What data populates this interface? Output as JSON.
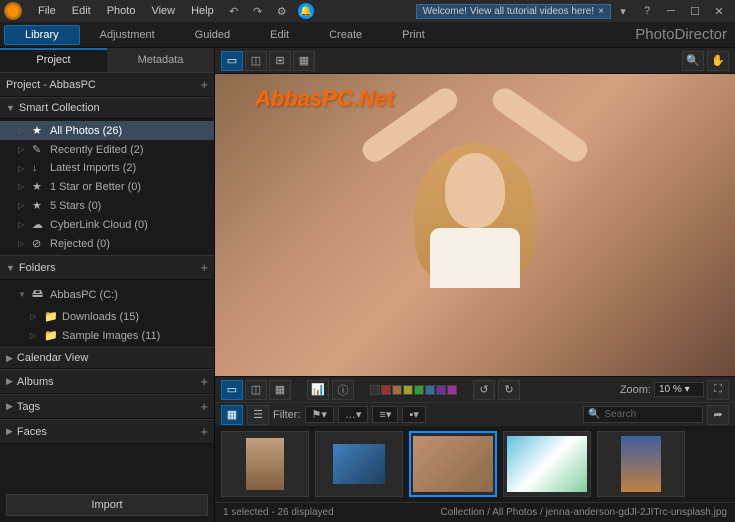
{
  "menu": {
    "file": "File",
    "edit": "Edit",
    "photo": "Photo",
    "view": "View",
    "help": "Help"
  },
  "welcome_banner": "Welcome! View all tutorial videos here!",
  "brand": "PhotoDirector",
  "modes": {
    "library": "Library",
    "adjustment": "Adjustment",
    "guided": "Guided",
    "edit": "Edit",
    "create": "Create",
    "print": "Print"
  },
  "side_tabs": {
    "project": "Project",
    "metadata": "Metadata"
  },
  "project_header": "Project - AbbasPC",
  "panels": {
    "smart_collection": {
      "title": "Smart Collection",
      "items": [
        {
          "label": "All Photos (26)",
          "icon": "★"
        },
        {
          "label": "Recently Edited (2)",
          "icon": "✎"
        },
        {
          "label": "Latest Imports (2)",
          "icon": "↓"
        },
        {
          "label": "1 Star or Better (0)",
          "icon": "★"
        },
        {
          "label": "5 Stars (0)",
          "icon": "★"
        },
        {
          "label": "CyberLink Cloud (0)",
          "icon": "☁"
        },
        {
          "label": "Rejected (0)",
          "icon": "⊘"
        }
      ]
    },
    "folders": {
      "title": "Folders",
      "root": "AbbasPC (C:)",
      "children": [
        {
          "label": "Downloads (15)"
        },
        {
          "label": "Sample Images (11)"
        }
      ]
    },
    "calendar": "Calendar View",
    "albums": "Albums",
    "tags": "Tags",
    "faces": "Faces"
  },
  "import_btn": "Import",
  "watermark": "AbbasPC.Net",
  "filmstrip_toolbar": {
    "zoom_label": "Zoom:",
    "zoom_value": "10 %"
  },
  "filter_toolbar": {
    "filter_label": "Filter:",
    "search_placeholder": "Search"
  },
  "statusbar": {
    "left": "1 selected - 26 displayed",
    "right": "Collection / All Photos / jenna-anderson-gdJl-2JITrc-unsplash.jpg"
  },
  "swatch_colors": [
    "#333",
    "#a03030",
    "#a07030",
    "#a0a030",
    "#30a030",
    "#3070a0",
    "#7030a0",
    "#a030a0"
  ]
}
